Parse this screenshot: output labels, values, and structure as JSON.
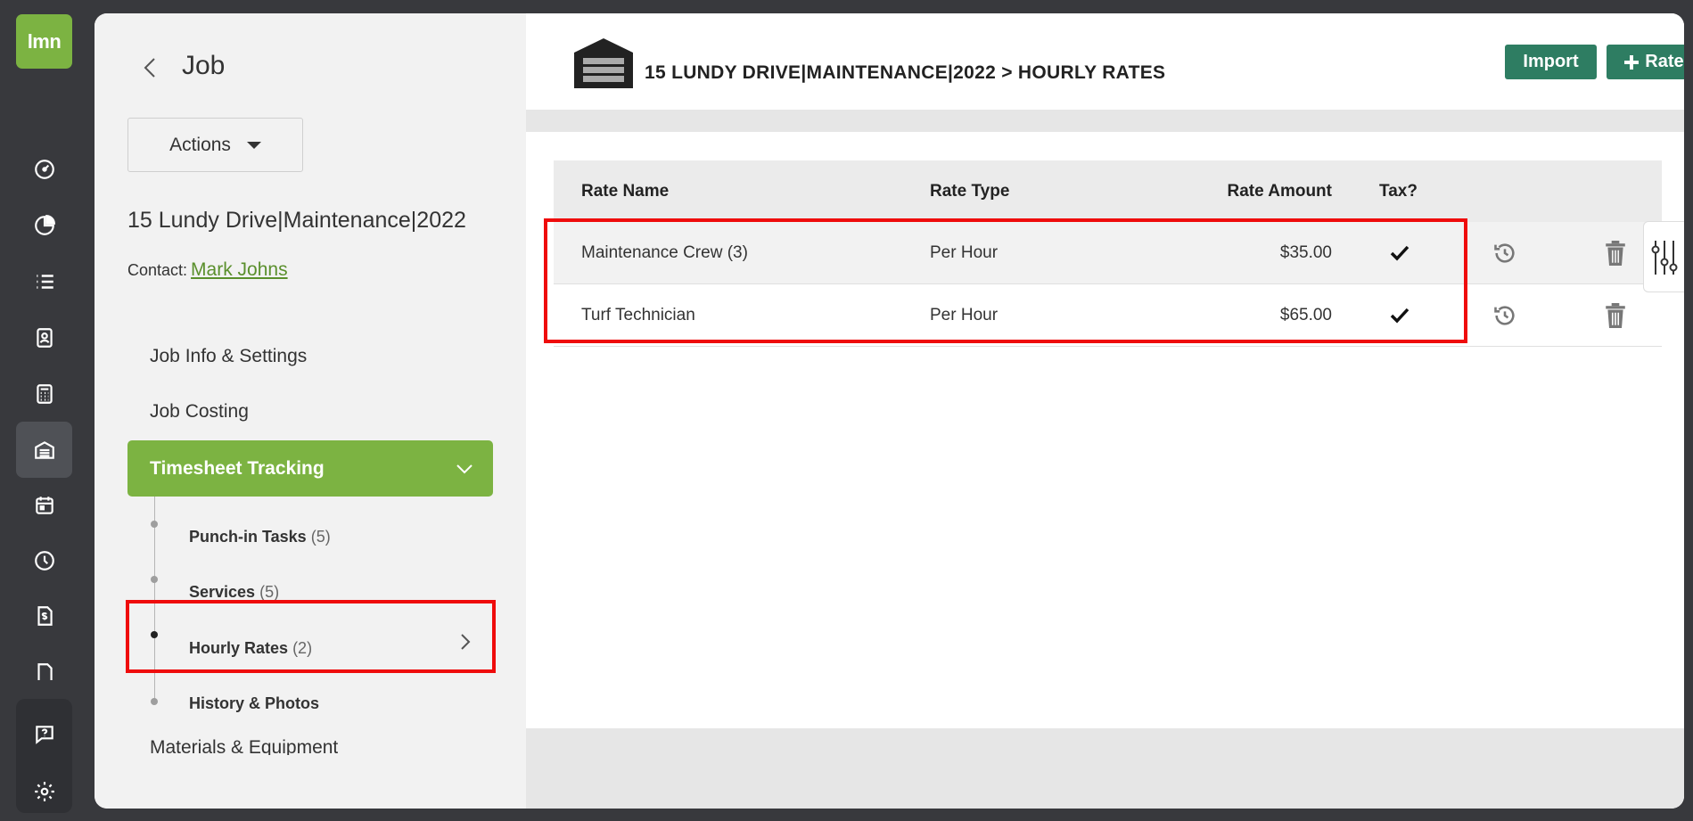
{
  "app": {
    "logo_text": "lmn",
    "brand_color": "#7cb342"
  },
  "rail": {
    "icons": [
      "dashboard-icon",
      "pie-chart-icon",
      "list-icon",
      "contact-card-icon",
      "calculator-icon",
      "garage-icon",
      "calendar-icon",
      "clock-icon",
      "invoice-icon",
      "document-icon",
      "help-icon",
      "settings-icon"
    ],
    "active": "garage-icon"
  },
  "sidebar": {
    "title": "Job",
    "actions_label": "Actions",
    "job_name": "15 Lundy Drive|Maintenance|2022",
    "contact_label": "Contact:",
    "contact_name": "Mark Johns",
    "nav": {
      "job_info": "Job Info & Settings",
      "job_costing": "Job Costing",
      "timesheet": "Timesheet Tracking",
      "materials": "Materials & Equipment"
    },
    "sub": [
      {
        "label": "Punch-in Tasks",
        "count": "(5)"
      },
      {
        "label": "Services",
        "count": "(5)"
      },
      {
        "label": "Hourly Rates",
        "count": "(2)"
      },
      {
        "label": "History & Photos",
        "count": ""
      }
    ]
  },
  "header": {
    "breadcrumb": "15 LUNDY DRIVE|MAINTENANCE|2022 > HOURLY RATES",
    "import_label": "Import",
    "rates_label": "Rates",
    "button_color": "#2e7d62"
  },
  "table": {
    "columns": [
      "Rate Name",
      "Rate Type",
      "Rate Amount",
      "Tax?"
    ],
    "rows": [
      {
        "name": "Maintenance Crew (3)",
        "type": "Per Hour",
        "amount": "$35.00",
        "tax": true
      },
      {
        "name": "Turf Technician",
        "type": "Per Hour",
        "amount": "$65.00",
        "tax": true
      }
    ]
  },
  "highlight_color": "#ef0c0c"
}
